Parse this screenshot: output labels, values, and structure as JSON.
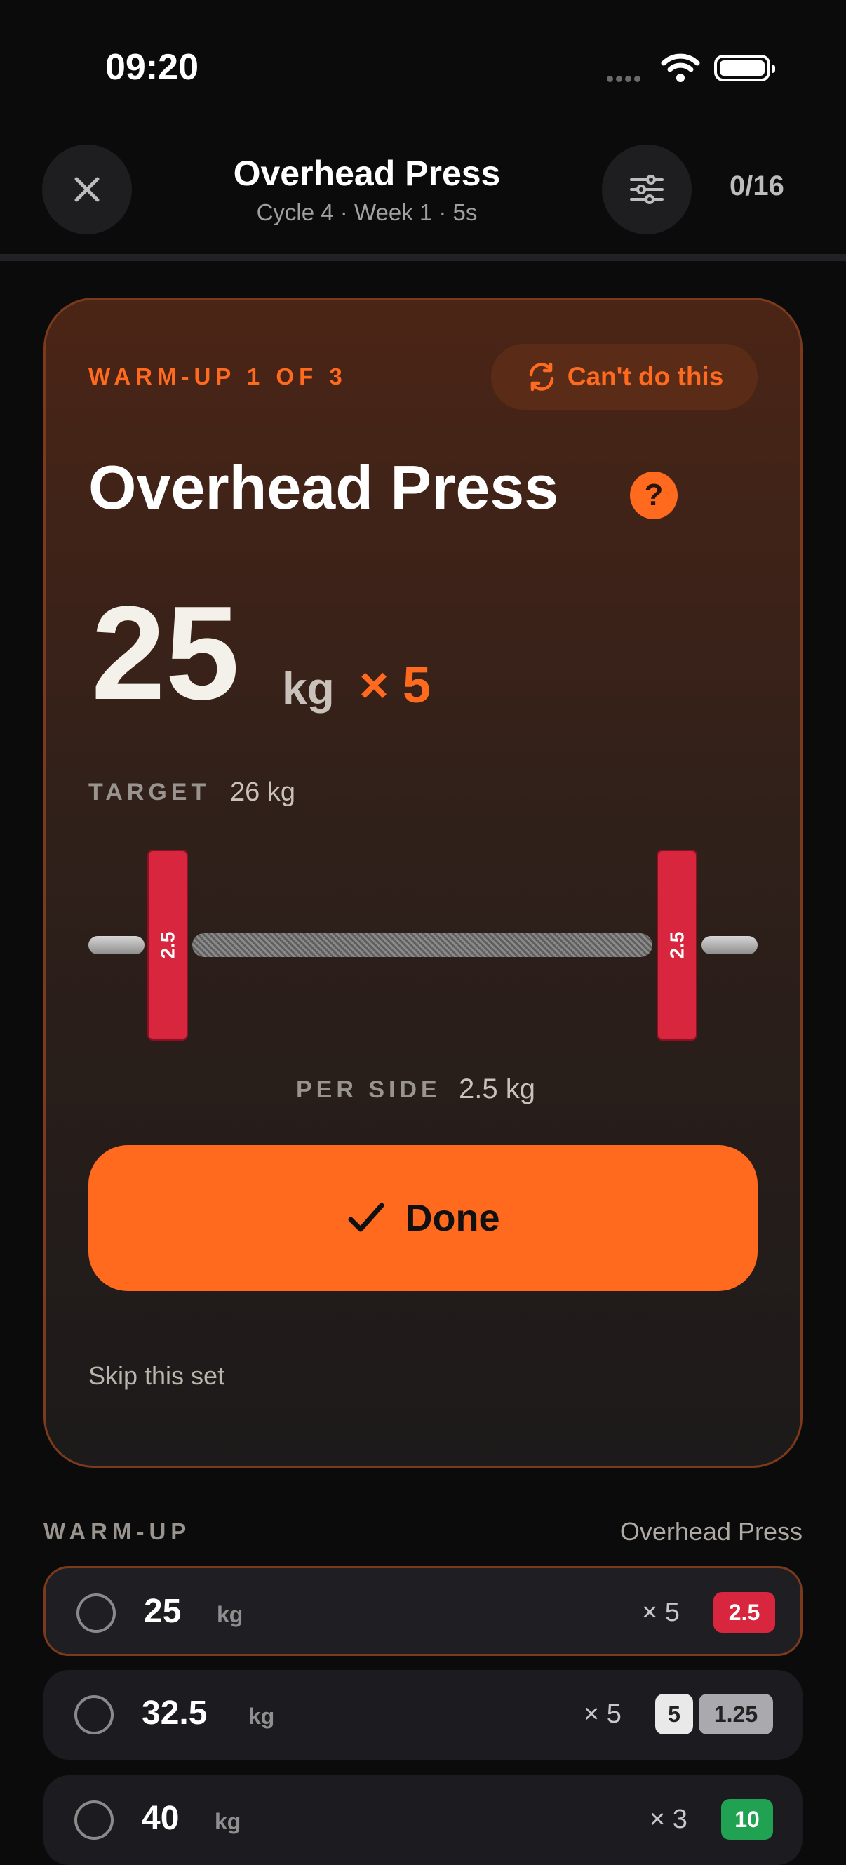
{
  "status": {
    "time": "09:20"
  },
  "header": {
    "title": "Overhead Press",
    "subtitle": "Cycle 4 · Week 1 · 5s",
    "progress": "0/16"
  },
  "card": {
    "set_label": "WARM-UP 1 OF 3",
    "cant_do_label": "Can't do this",
    "exercise": "Overhead Press",
    "help_glyph": "?",
    "weight": "25",
    "unit": "kg",
    "reps": "× 5",
    "target_label": "TARGET",
    "target_value": "26 kg",
    "plates": {
      "left": "2.5",
      "right": "2.5",
      "color": "#d7263d"
    },
    "per_side_label": "PER SIDE",
    "per_side_value": "2.5 kg",
    "done_label": "Done",
    "skip_label": "Skip this set"
  },
  "list": {
    "section_label": "WARM-UP",
    "section_exercise": "Overhead Press",
    "rows": [
      {
        "weight": "25",
        "unit": "kg",
        "reps": "× 5",
        "chips": [
          {
            "text": "2.5",
            "bg": "#d7263d",
            "fg": "#ffffff"
          }
        ]
      },
      {
        "weight": "32.5",
        "unit": "kg",
        "reps": "× 5",
        "chips": [
          {
            "text": "5",
            "bg": "#e9e9e9",
            "fg": "#222222"
          },
          {
            "text": "1.25",
            "bg": "#a9a9ae",
            "fg": "#222222"
          }
        ]
      },
      {
        "weight": "40",
        "unit": "kg",
        "reps": "× 3",
        "chips": [
          {
            "text": "10",
            "bg": "#21a152",
            "fg": "#ffffff"
          }
        ]
      }
    ]
  },
  "colors": {
    "accent": "#ff6a1f",
    "background": "#0b0b0b"
  }
}
